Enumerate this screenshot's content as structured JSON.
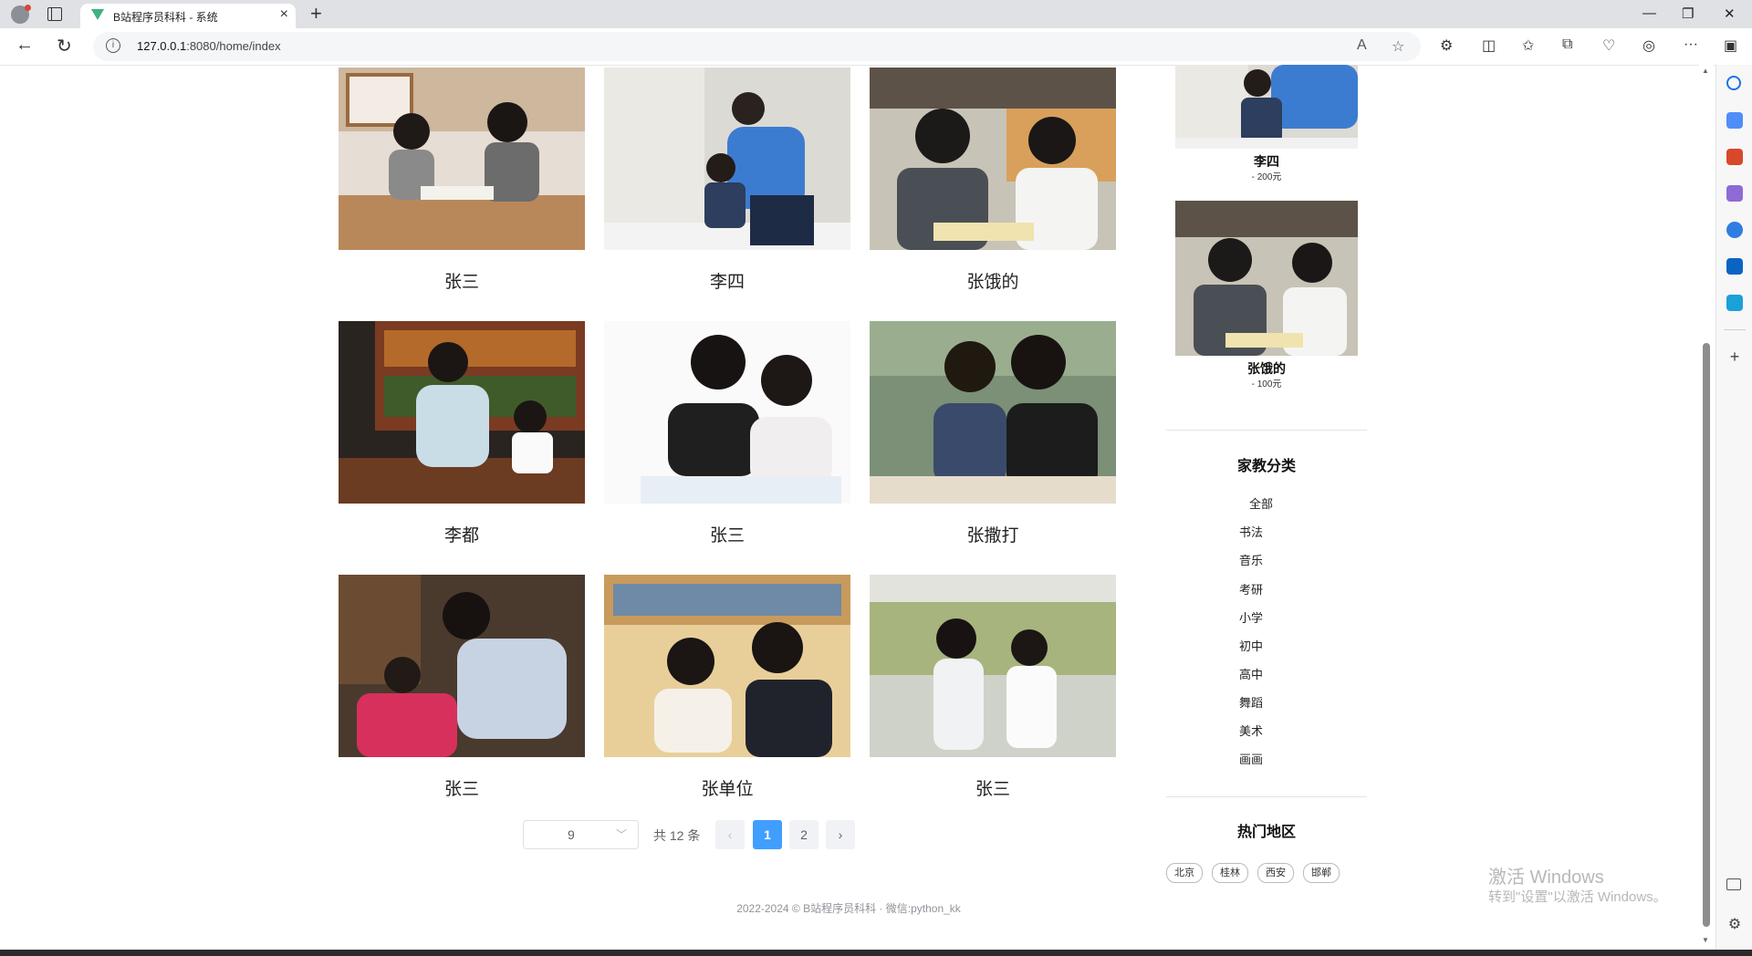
{
  "browser": {
    "tab_title": "B站程序员科科 - 系统",
    "url_host": "127.0.0.1",
    "url_rest": ":8080/home/index"
  },
  "teachers": [
    {
      "name": "张三"
    },
    {
      "name": "李四"
    },
    {
      "name": "张饿的"
    },
    {
      "name": "李都"
    },
    {
      "name": "张三"
    },
    {
      "name": "张撒打"
    },
    {
      "name": "张三"
    },
    {
      "name": "张单位"
    },
    {
      "name": "张三"
    }
  ],
  "pagination": {
    "page_size": "9",
    "total": "共 12 条",
    "prev": "‹",
    "pages": [
      "1",
      "2"
    ],
    "next": "›"
  },
  "footer": "2022-2024 © B站程序员科科 · 微信:python_kk",
  "sidebar": {
    "hot": [
      {
        "name": "李四",
        "price": "- 200元"
      },
      {
        "name": "张饿的",
        "price": "- 100元"
      }
    ],
    "categories_title": "家教分类",
    "categories": [
      "全部",
      "书法",
      "音乐",
      "考研",
      "小学",
      "初中",
      "高中",
      "舞蹈",
      "美术",
      "画画"
    ],
    "regions_title": "热门地区",
    "regions": [
      "北京",
      "桂林",
      "西安",
      "邯郸"
    ]
  },
  "watermark": {
    "title": "激活 Windows",
    "subtitle": "转到\"设置\"以激活 Windows。"
  },
  "colors": {
    "accent": "#409eff"
  }
}
